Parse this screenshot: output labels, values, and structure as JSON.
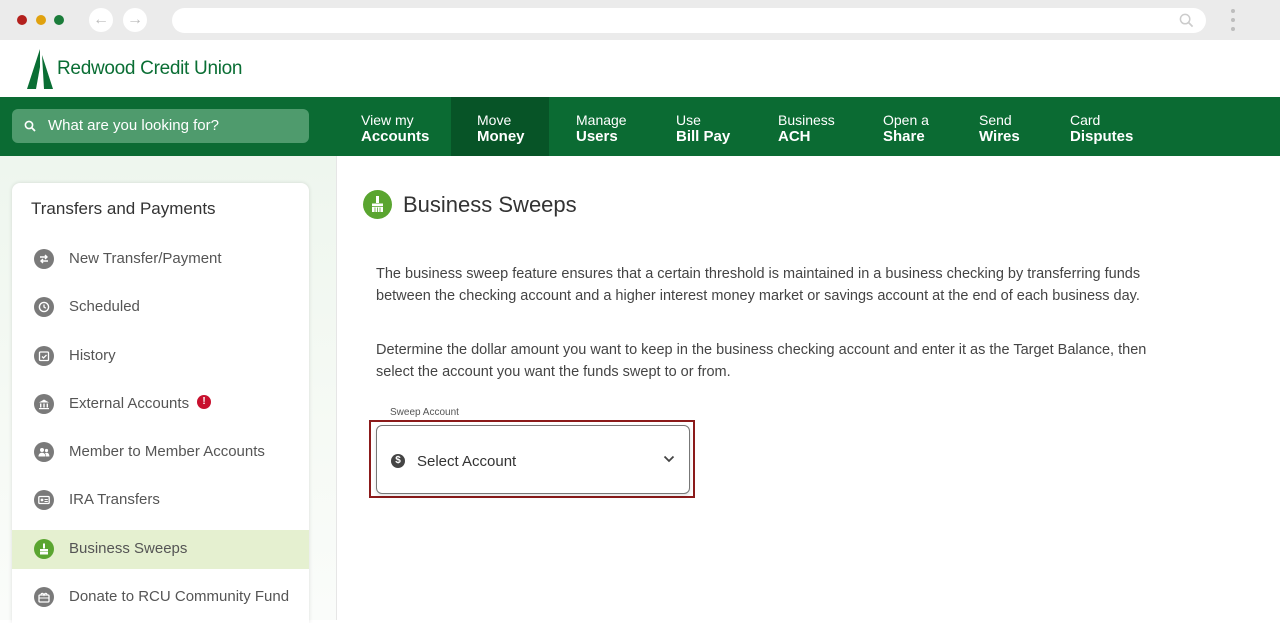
{
  "bank": {
    "name": "Redwood Credit Union"
  },
  "search": {
    "placeholder": "What are you looking for?"
  },
  "nav": [
    {
      "l1": "View my",
      "l2": "Accounts"
    },
    {
      "l1": "Move",
      "l2": "Money"
    },
    {
      "l1": "Manage",
      "l2": "Users"
    },
    {
      "l1": "Use",
      "l2": "Bill Pay"
    },
    {
      "l1": "Business",
      "l2": "ACH"
    },
    {
      "l1": "Open a",
      "l2": "Share"
    },
    {
      "l1": "Send",
      "l2": "Wires"
    },
    {
      "l1": "Card",
      "l2": "Disputes"
    }
  ],
  "sidebar": {
    "title": "Transfers and Payments",
    "items": [
      {
        "label": "New Transfer/Payment",
        "icon": "transfer-icon"
      },
      {
        "label": "Scheduled",
        "icon": "clock-icon"
      },
      {
        "label": "History",
        "icon": "calendar-icon"
      },
      {
        "label": "External Accounts",
        "icon": "bank-icon",
        "alert": "!"
      },
      {
        "label": "Member to Member Accounts",
        "icon": "people-icon"
      },
      {
        "label": "IRA Transfers",
        "icon": "ira-icon"
      },
      {
        "label": "Business Sweeps",
        "icon": "broom-icon"
      },
      {
        "label": "Donate to RCU Community Fund",
        "icon": "gift-icon"
      }
    ]
  },
  "main": {
    "title": "Business Sweeps",
    "para1": "The business sweep feature ensures that a certain threshold is maintained in a business checking by transferring funds between the checking account and a higher interest money market or savings account at the end of each business day.",
    "para2": "Determine the dollar amount you want to keep in the business checking account and enter it as the Target Balance, then select the account you want the funds swept to or from.",
    "sweep_label": "Sweep Account",
    "select_value": "Select Account",
    "dollar_glyph": "$"
  },
  "colors": {
    "brand_green": "#0b6b33",
    "accent_green": "#5aa530",
    "highlight": "#8b1a1a"
  }
}
